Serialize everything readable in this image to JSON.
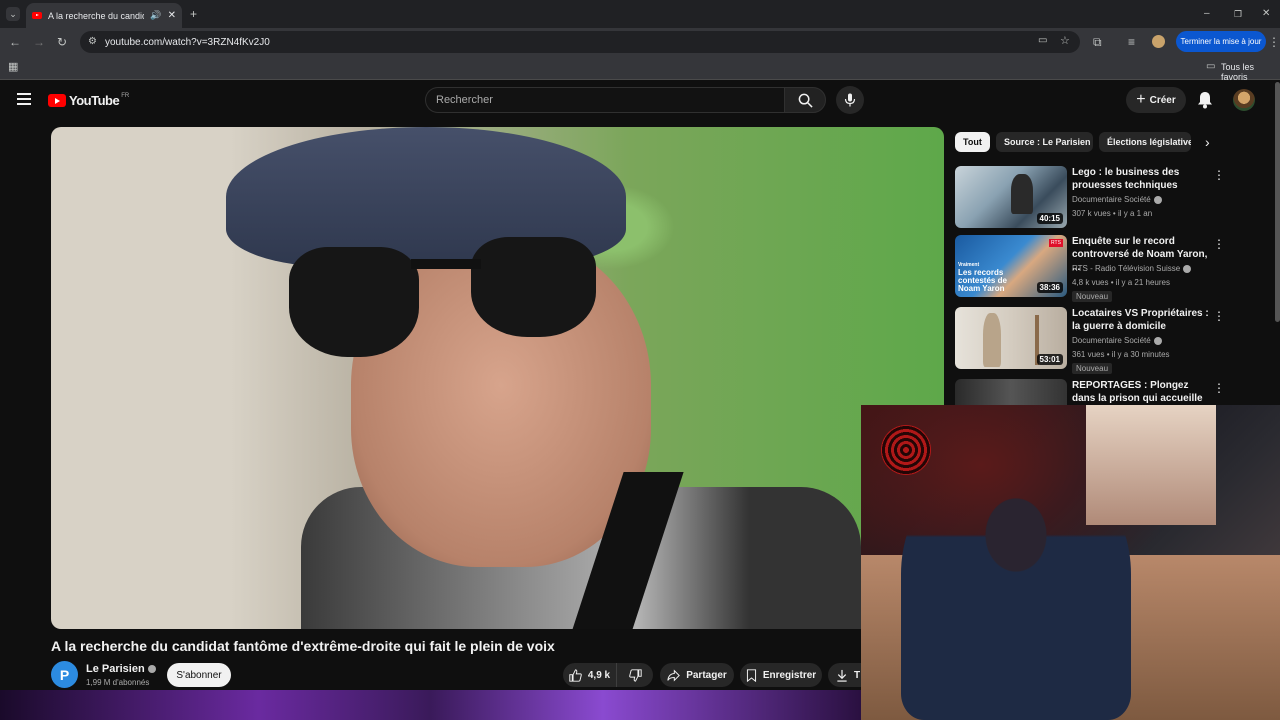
{
  "browser": {
    "tab_title": "A la recherche du candidat",
    "url": "youtube.com/watch?v=3RZN4fKv2J0",
    "update_button": "Terminer la mise à jour",
    "bookmarks_label": "Tous les favoris"
  },
  "header": {
    "logo_text": "YouTube",
    "region": "FR",
    "search_placeholder": "Rechercher",
    "create_label": "Créer"
  },
  "video": {
    "title": "A la recherche du candidat fantôme d'extrême-droite qui fait le plein de voix",
    "channel_name": "Le Parisien",
    "channel_initial": "P",
    "subscribers": "1,99 M d'abonnés",
    "subscribe_label": "S'abonner",
    "likes": "4,9 k",
    "share_label": "Partager",
    "save_label": "Enregistrer",
    "download_label": "T"
  },
  "chips": [
    "Tout",
    "Source : Le Parisien",
    "Élections législatives"
  ],
  "recommendations": [
    {
      "title": "Lego : le business des prouesses techniques",
      "channel": "Documentaire Société",
      "meta": "307 k vues • il y a 1 an",
      "duration": "40:15",
      "badge": ""
    },
    {
      "title": "Enquête sur le record controversé de Noam Yaron, ...",
      "channel": "RTS - Radio Télévision Suisse",
      "meta": "4,8 k vues • il y a 21 heures",
      "duration": "38:36",
      "badge": "Nouveau",
      "thumb_text": "Les records contestés de Noam Yaron",
      "thumb_small": "Vraiment",
      "thumb_logo": "RTS"
    },
    {
      "title": "Locataires VS Propriétaires : la guerre à domicile",
      "channel": "Documentaire Société",
      "meta": "361 vues • il y a 30 minutes",
      "duration": "53:01",
      "badge": "Nouveau"
    },
    {
      "title": "REPORTAGES : Plongez dans la prison qui accueille les détenu...",
      "channel": "",
      "meta": "",
      "duration": "",
      "badge": ""
    }
  ],
  "colors": {
    "yt_red": "#ff0000",
    "update_blue": "#0b57d0",
    "bg": "#0f0f0f"
  }
}
